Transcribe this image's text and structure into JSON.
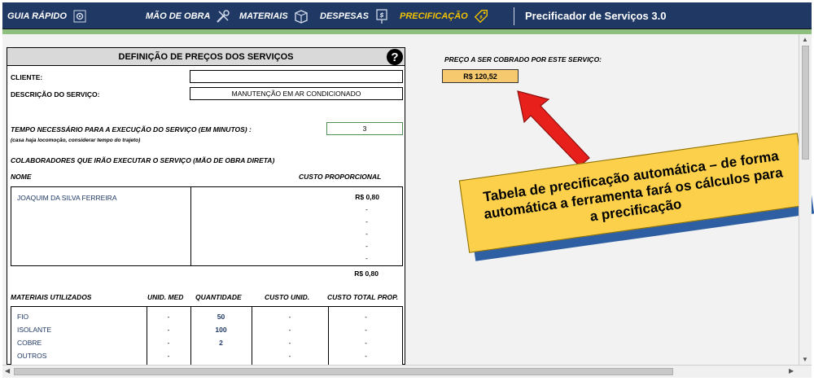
{
  "nav": {
    "items": [
      {
        "label": "GUIA RÁPIDO",
        "icon": "gear-icon"
      },
      {
        "label": "MÃO DE OBRA",
        "icon": "tools-icon"
      },
      {
        "label": "MATERIAIS",
        "icon": "box-icon"
      },
      {
        "label": "DESPESAS",
        "icon": "money-icon"
      },
      {
        "label": "PRECIFICAÇÃO",
        "icon": "price-tag-icon"
      }
    ],
    "active": "PRECIFICAÇÃO",
    "app_title": "Precificador de Serviços 3.0"
  },
  "form": {
    "header": "DEFINIÇÃO DE PREÇOS DOS SERVIÇOS",
    "cliente_label": "CLIENTE:",
    "cliente_value": "",
    "descricao_label": "DESCRIÇÃO DO SERVIÇO:",
    "descricao_value": "MANUTENÇÃO EM AR CONDICIONADO",
    "tempo_label": "TEMPO NECESSÁRIO PARA A EXECUÇÃO DO SERVIÇO (EM MINUTOS) :",
    "tempo_note": "(casa haja locomoção, considerar tempo do trajeto)",
    "tempo_value": "3",
    "colaboradores_title": "COLABORADORES QUE IRÃO EXECUTAR O SERVIÇO (MÃO DE OBRA DIRETA)",
    "nome_header": "NOME",
    "custo_prop_header": "CUSTO PROPORCIONAL",
    "colaboradores": [
      {
        "nome": "JOAQUIM DA SILVA FERREIRA",
        "custo": "R$ 0,80"
      },
      {
        "nome": "",
        "custo": "-"
      },
      {
        "nome": "",
        "custo": "-"
      },
      {
        "nome": "",
        "custo": "-"
      },
      {
        "nome": "",
        "custo": "-"
      },
      {
        "nome": "",
        "custo": "-"
      }
    ],
    "colaboradores_total": "R$ 0,80",
    "materiais_headers": [
      "MATERIAIS UTILIZADOS",
      "UNID. MED",
      "QUANTIDADE",
      "CUSTO UNID.",
      "CUSTO TOTAL PROP."
    ],
    "materiais": [
      {
        "nome": "FIO",
        "unid": "-",
        "qtd": "50",
        "custo_unid": "-",
        "custo_total": "-"
      },
      {
        "nome": "ISOLANTE",
        "unid": "-",
        "qtd": "100",
        "custo_unid": "-",
        "custo_total": "-"
      },
      {
        "nome": "COBRE",
        "unid": "-",
        "qtd": "2",
        "custo_unid": "-",
        "custo_total": "-"
      },
      {
        "nome": "OUTROS",
        "unid": "-",
        "qtd": "",
        "custo_unid": "-",
        "custo_total": "-"
      }
    ]
  },
  "price": {
    "label": "PREÇO A SER COBRADO POR ESTE SERVIÇO:",
    "value": "R$ 120,52"
  },
  "callout": {
    "lines": [
      "Tabela de precificação automática – de forma",
      "automática a ferramenta fará os cálculos para",
      "a precificação"
    ]
  },
  "colors": {
    "nav_bg": "#1f3864",
    "nav_active": "#f2c200",
    "accent_green": "#8fbf7f",
    "price_bg": "#f7c96e",
    "callout_bg": "#fcd04b",
    "callout_shadow": "#2e5fa3",
    "arrow": "#e8201c"
  }
}
